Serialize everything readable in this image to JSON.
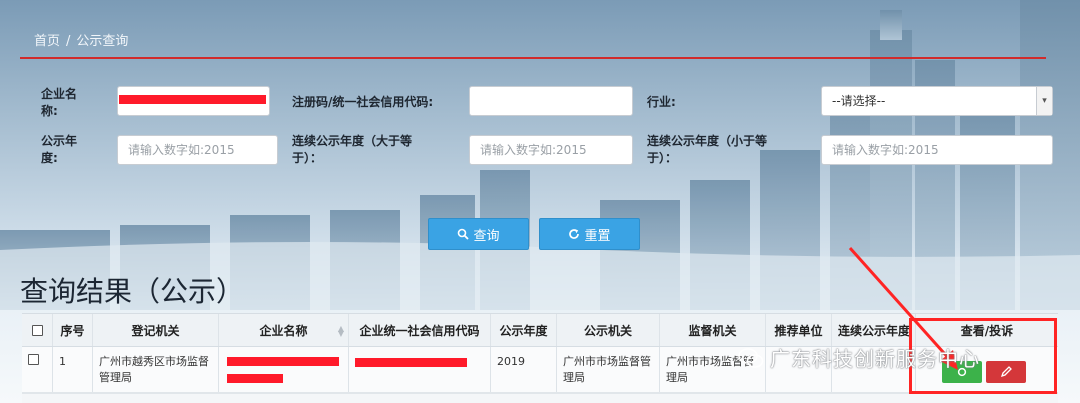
{
  "breadcrumb": {
    "home": "首页",
    "separator": "/",
    "current": "公示查询"
  },
  "form": {
    "company_name_label_1": "企业名",
    "company_name_label_2": "称:",
    "credit_code_label": "注册码/统一社会信用代码:",
    "credit_code_value": "",
    "industry_label": "行业:",
    "industry_value": "--请选择--",
    "year_label_1": "公示年",
    "year_label_2": "度:",
    "year_placeholder": "请输入数字如:2015",
    "cont_gt_label_1": "连续公示年度（大于等",
    "cont_gt_label_2": "于）：",
    "cont_gt_placeholder": "请输入数字如:2015",
    "cont_lt_label_1": "连续公示年度（小于等",
    "cont_lt_label_2": "于）：",
    "cont_lt_placeholder": "请输入数字如:2015"
  },
  "buttons": {
    "search": "查询",
    "reset": "重置"
  },
  "results": {
    "title": "查询结果（公示）",
    "columns": [
      "序号",
      "登记机关",
      "企业名称",
      "企业统一社会信用代码",
      "公示年度",
      "公示机关",
      "监督机关",
      "推荐单位",
      "连续公示年度",
      "查看/投诉"
    ],
    "rows": [
      {
        "index": "1",
        "registration_authority": "广州市越秀区市场监督管理局",
        "year": "2019",
        "publishing_authority": "广州市市场监督管理局",
        "supervising_authority": "广州市市场监督管理局"
      }
    ]
  },
  "watermark": "广东科技创新服务中心",
  "colors": {
    "accent_blue": "#3aa3e4",
    "divider_red": "#d12b2b",
    "view_green": "#3cb24a",
    "complain_red": "#d4373a",
    "highlight": "#ff2424"
  },
  "icons": {
    "search": "search-icon",
    "reset": "refresh-icon",
    "view": "eye-icon",
    "complain": "edit-icon",
    "dropdown": "chevron-down-icon"
  }
}
